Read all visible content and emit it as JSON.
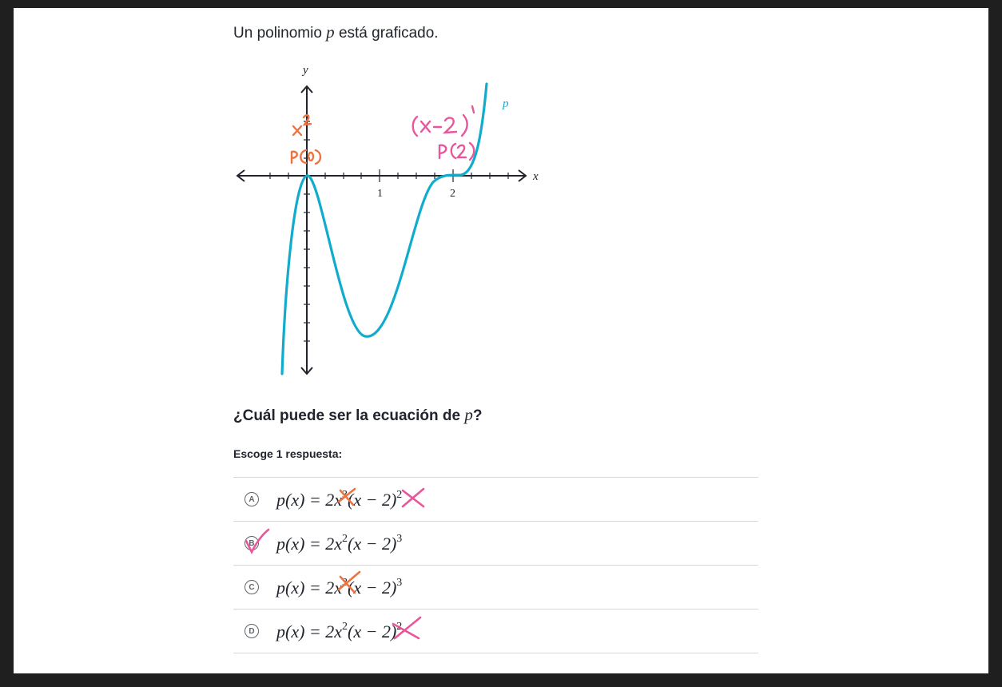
{
  "intro": {
    "text_before": "Un polinomio ",
    "var": "p",
    "text_after": " está graficado."
  },
  "graph": {
    "axis_x_label": "x",
    "axis_y_label": "y",
    "tick_1": "1",
    "tick_2": "2",
    "curve_label": "p",
    "curve_color": "#11accd",
    "annotations": {
      "x_squared": "x²",
      "p_zero": "P(0)",
      "x_minus_2": "(x−2)",
      "p_two": "P(2)"
    }
  },
  "question": {
    "text": "¿Cuál puede ser la ecuación de ",
    "var": "p",
    "end": "?"
  },
  "instruction": "Escoge 1 respuesta:",
  "choices": [
    {
      "letter": "A",
      "lhs": "p(x) = 2",
      "base": "x",
      "exp1": "3",
      "mid": "(x − 2)",
      "exp2": "2"
    },
    {
      "letter": "B",
      "lhs": "p(x) = 2",
      "base": "x",
      "exp1": "2",
      "mid": "(x − 2)",
      "exp2": "3"
    },
    {
      "letter": "C",
      "lhs": "p(x) = 2",
      "base": "x",
      "exp1": "3",
      "mid": "(x − 2)",
      "exp2": "3"
    },
    {
      "letter": "D",
      "lhs": "p(x) = 2",
      "base": "x",
      "exp1": "2",
      "mid": "(x − 2)",
      "exp2": "2"
    }
  ],
  "colors": {
    "ink_pink": "#e8569b",
    "ink_orange": "#ee7340",
    "text": "#21242c"
  }
}
